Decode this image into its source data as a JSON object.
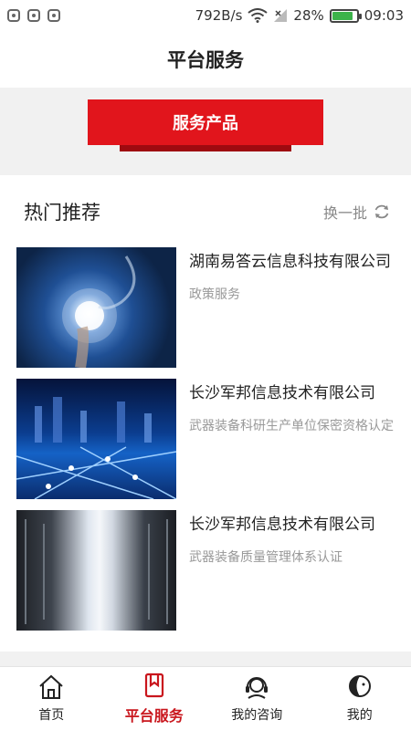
{
  "status_bar": {
    "speed": "792B/s",
    "battery_percent": "28%",
    "battery_level": 0.85,
    "time": "09:03"
  },
  "header": {
    "title": "平台服务"
  },
  "banner": {
    "button_label": "服务产品"
  },
  "hot": {
    "title": "热门推荐",
    "refresh_label": "换一批",
    "items": [
      {
        "title": "湖南易答云信息科技有限公司",
        "subtitle": "政策服务"
      },
      {
        "title": "长沙军邦信息技术有限公司",
        "subtitle": "武器装备科研生产单位保密资格认定"
      },
      {
        "title": "长沙军邦信息技术有限公司",
        "subtitle": "武器装备质量管理体系认证"
      }
    ]
  },
  "nav": {
    "accent": "#c9161d",
    "items": [
      {
        "label": "首页",
        "icon": "home-icon"
      },
      {
        "label": "平台服务",
        "icon": "bookmark-icon"
      },
      {
        "label": "我的咨询",
        "icon": "headset-icon"
      },
      {
        "label": "我的",
        "icon": "profile-icon"
      }
    ]
  }
}
